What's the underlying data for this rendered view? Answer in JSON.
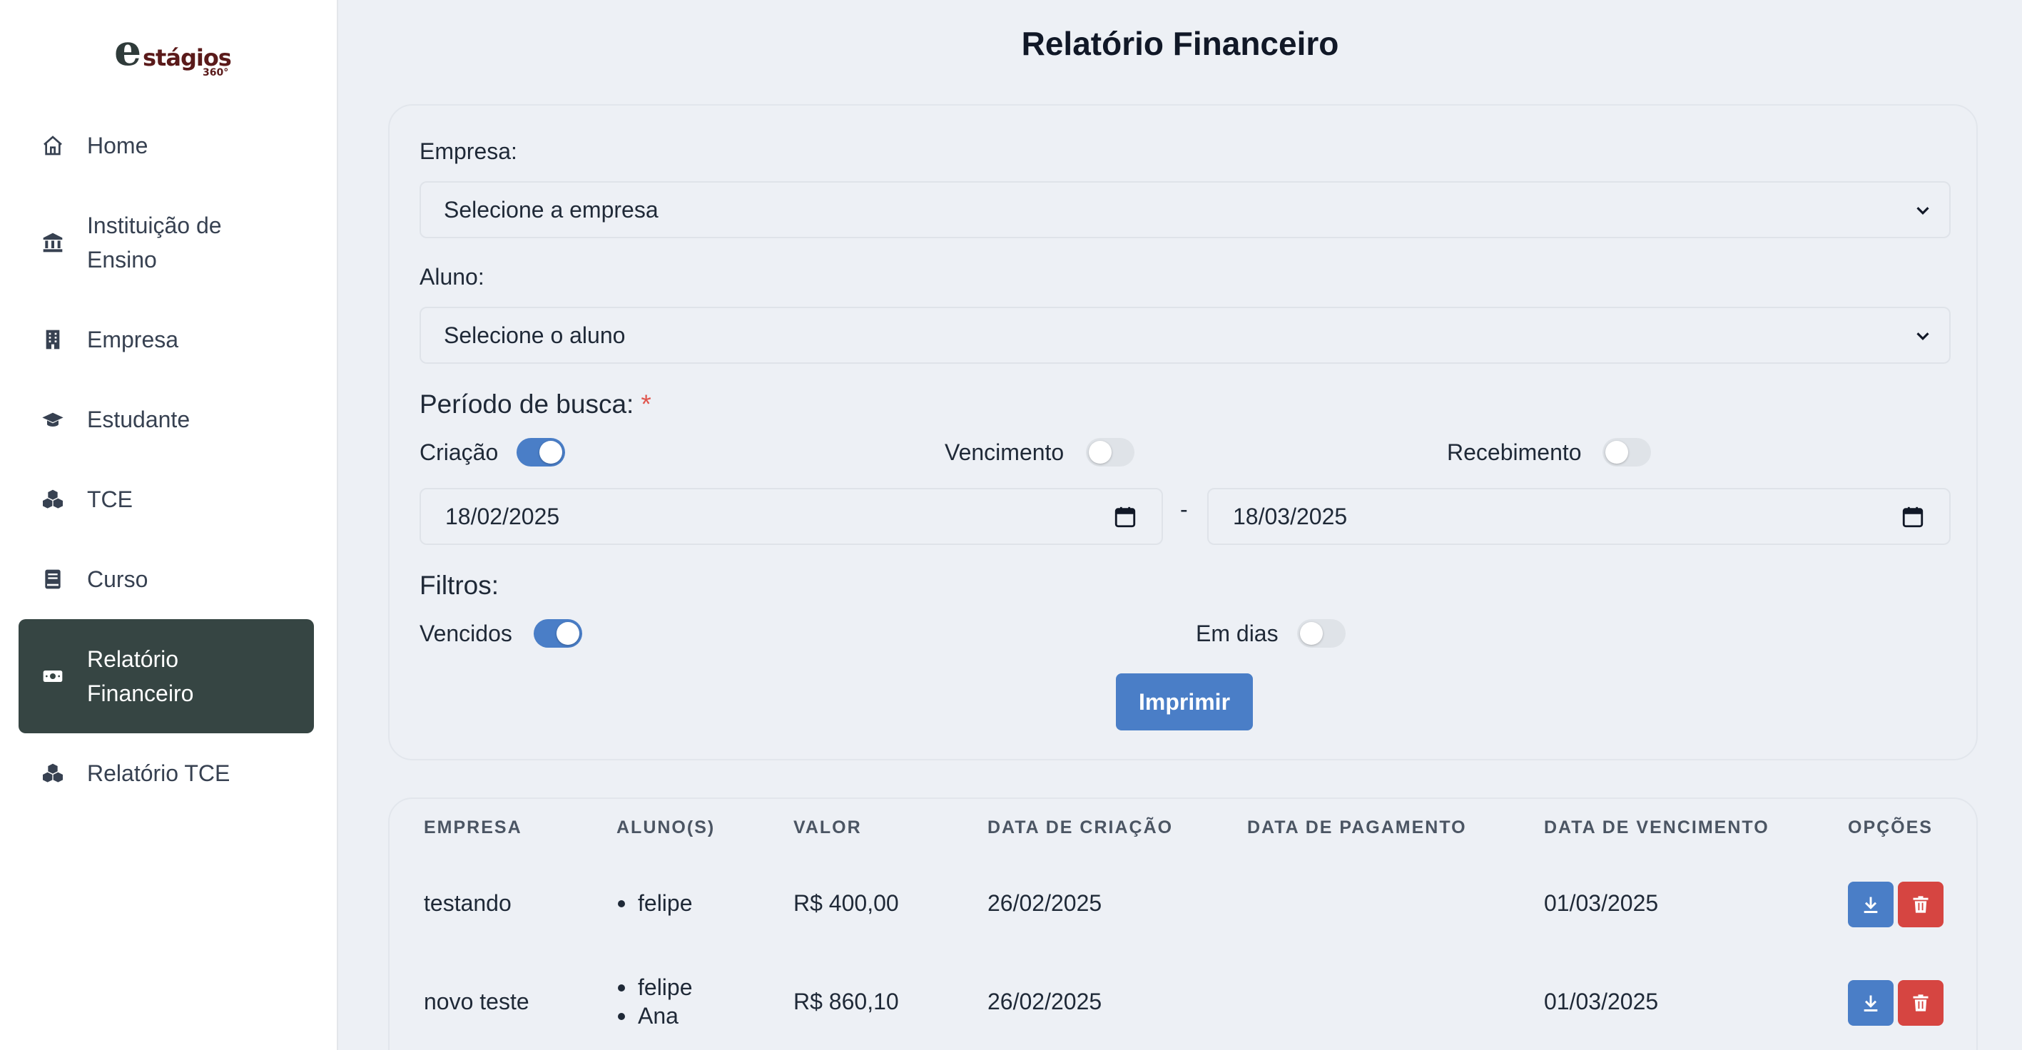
{
  "logo": {
    "letter": "e",
    "word": "stágios",
    "degree": "360°"
  },
  "sidebar": {
    "items": [
      {
        "label": "Home",
        "icon": "home-icon"
      },
      {
        "label": "Instituição de Ensino",
        "icon": "bank-icon"
      },
      {
        "label": "Empresa",
        "icon": "building-icon"
      },
      {
        "label": "Estudante",
        "icon": "graduation-cap-icon"
      },
      {
        "label": "TCE",
        "icon": "cubes-icon"
      },
      {
        "label": "Curso",
        "icon": "book-icon"
      },
      {
        "label": "Relatório Financeiro",
        "icon": "money-bill-icon",
        "active": true
      },
      {
        "label": "Relatório TCE",
        "icon": "cubes-icon"
      }
    ]
  },
  "page": {
    "title": "Relatório Financeiro"
  },
  "form": {
    "empresa_label": "Empresa:",
    "empresa_value": "Selecione a empresa",
    "aluno_label": "Aluno:",
    "aluno_value": "Selecione o aluno",
    "periodo_label": "Período de busca:",
    "required_mark": "*",
    "toggles": {
      "criacao": {
        "label": "Criação",
        "on": true
      },
      "vencimento": {
        "label": "Vencimento",
        "on": false
      },
      "recebimento": {
        "label": "Recebimento",
        "on": false
      }
    },
    "date_from": "18/02/2025",
    "date_separator": "-",
    "date_to": "18/03/2025",
    "filtros_label": "Filtros:",
    "filtros": {
      "vencidos": {
        "label": "Vencidos",
        "on": true
      },
      "em_dias": {
        "label": "Em dias",
        "on": false
      }
    },
    "print_button": "Imprimir"
  },
  "table": {
    "headers": {
      "empresa": "EMPRESA",
      "alunos": "ALUNO(S)",
      "valor": "VALOR",
      "criacao": "DATA DE CRIAÇÃO",
      "pagamento": "DATA DE PAGAMENTO",
      "vencimento": "DATA DE VENCIMENTO",
      "opcoes": "OPÇÕES"
    },
    "rows": [
      {
        "empresa": "testando",
        "alunos": [
          "felipe"
        ],
        "valor": "R$ 400,00",
        "criacao": "26/02/2025",
        "pagamento": "",
        "vencimento": "01/03/2025"
      },
      {
        "empresa": "novo teste",
        "alunos": [
          "felipe",
          "Ana"
        ],
        "valor": "R$ 860,10",
        "criacao": "26/02/2025",
        "pagamento": "",
        "vencimento": "01/03/2025"
      }
    ]
  },
  "colors": {
    "accent": "#4a7ec7",
    "danger": "#d64541",
    "sidebar_active": "#364543"
  }
}
